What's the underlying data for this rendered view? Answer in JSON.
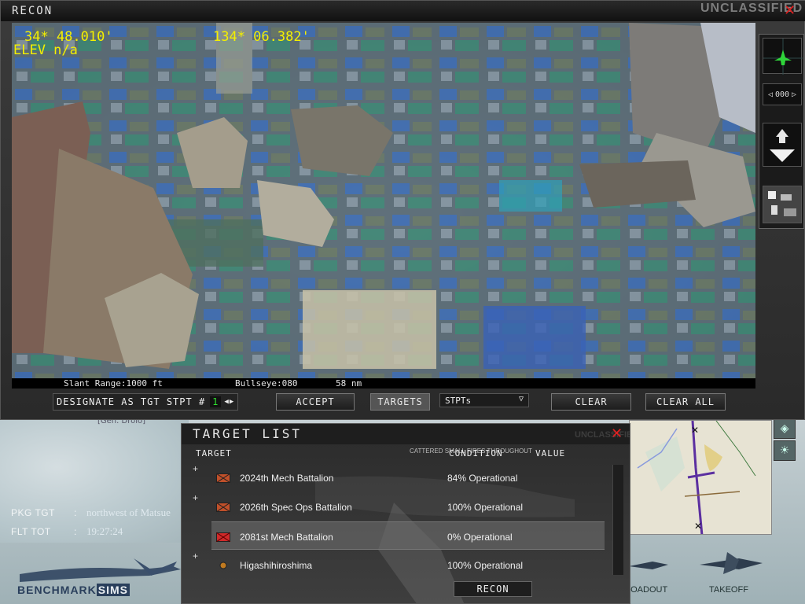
{
  "recon": {
    "title": "RECON",
    "classification": "UNCLASSIFIED",
    "hud": {
      "latitude": "34* 48.010'",
      "longitude": "134* 06.382'",
      "elevation": "ELEV n/a"
    },
    "status": {
      "slant_range": "Slant Range:1000 ft",
      "bullseye": "Bullseye:080",
      "distance": "58 nm"
    },
    "right_panel": {
      "heading_readout": "000"
    },
    "controls": {
      "designate_label": "DESIGNATE AS TGT STPT #",
      "stpt_number": "1",
      "accept": "ACCEPT",
      "targets": "TARGETS",
      "stpts": "STPTs",
      "clear": "CLEAR",
      "clear_all": "CLEAR ALL"
    }
  },
  "mission": {
    "classification": "UNCLASSIFIED",
    "general_label": "[Gen. Drolo]",
    "pkg_tgt_label": "PKG TGT",
    "pkg_tgt_value": "northwest of Matsue",
    "flt_tot_label": "FLT TOT",
    "flt_tot_value": "19:27:24",
    "logo_text_a": "BENCHMARK",
    "logo_text_b": "SIMS",
    "tabs": [
      "LOADOUT",
      "TAKEOFF"
    ],
    "bg_note": "CATTERED SMALL FIRES THROUGHOUT"
  },
  "target_list": {
    "title": "TARGET LIST",
    "columns": {
      "target": "TARGET",
      "condition": "CONDITION",
      "value": "VALUE"
    },
    "rows": [
      {
        "name": "2024th Mech Battalion",
        "condition": "84% Operational",
        "icon": "battalion-icon",
        "color": "#c0502a"
      },
      {
        "name": "2026th Spec Ops Battalion",
        "condition": "100% Operational",
        "icon": "battalion-icon",
        "color": "#c0502a"
      },
      {
        "name": "2081st Mech Battalion",
        "condition": "0% Operational",
        "icon": "battalion-destroyed-icon",
        "color": "#d02a2a"
      },
      {
        "name": "Higashihiroshima",
        "condition": "100% Operational",
        "icon": "town-icon",
        "color": "#c07a20"
      }
    ],
    "recon_button": "RECON"
  }
}
